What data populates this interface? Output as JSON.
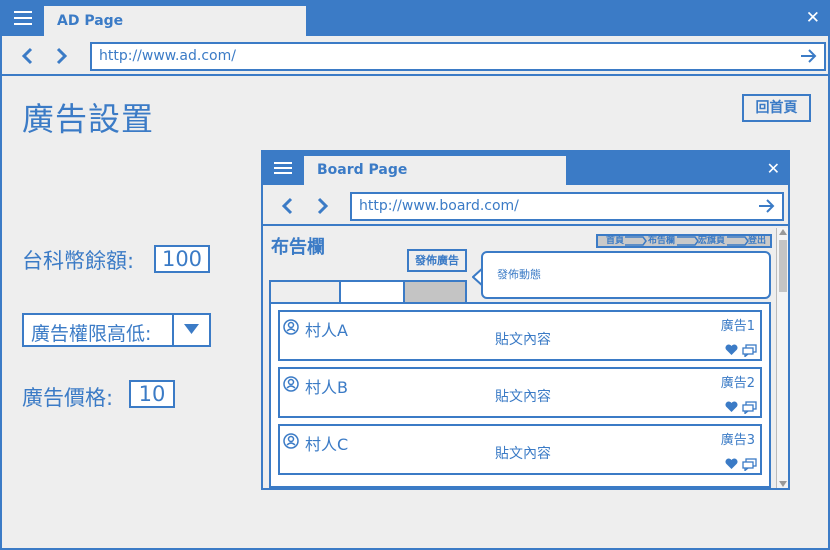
{
  "window": {
    "tab_title": "AD Page",
    "url": "http://www.ad.com/"
  },
  "page": {
    "title": "廣告設置",
    "home_button": "回首頁",
    "balance_label": "台科幣餘額:",
    "balance_value": "100",
    "permission_select": "廣告權限高低:",
    "price_label": "廣告價格:",
    "price_value": "10"
  },
  "board": {
    "tab_title": "Board Page",
    "url": "http://www.board.com/",
    "heading": "布告欄",
    "breadcrumb": [
      "首頁",
      "布告欄",
      "宏旗頁",
      "登出"
    ],
    "post_button": "發佈廣告",
    "bubble_text": "發佈動態",
    "posts": [
      {
        "user": "村人A",
        "content": "貼文內容",
        "ad_label": "廣告1"
      },
      {
        "user": "村人B",
        "content": "貼文內容",
        "ad_label": "廣告2"
      },
      {
        "user": "村人C",
        "content": "貼文內容",
        "ad_label": "廣告3"
      }
    ]
  },
  "colors": {
    "accent": "#3b7bc6",
    "background": "#eeeeee",
    "tab_inactive": "#c4c4c4"
  },
  "icons": [
    "menu-icon",
    "close-icon",
    "back-icon",
    "forward-icon",
    "go-arrow-icon",
    "chevron-down-icon",
    "user-icon",
    "heart-icon",
    "comment-icon"
  ]
}
